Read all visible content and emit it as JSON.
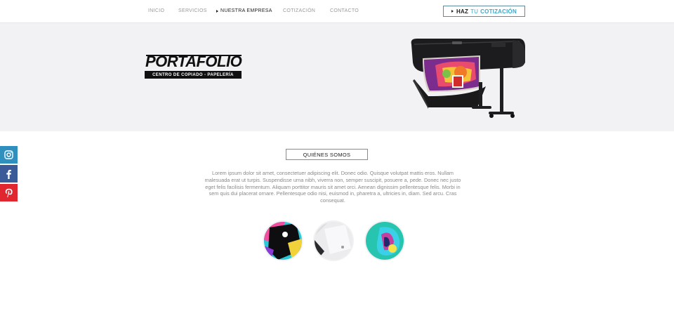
{
  "nav": {
    "items": [
      {
        "label": "INICIO",
        "active": false
      },
      {
        "label": "SERVICIOS",
        "active": false
      },
      {
        "label": "NUESTRA EMPRESA",
        "active": true
      },
      {
        "label": "COTIZACIÓN",
        "active": false
      },
      {
        "label": "CONTACTO",
        "active": false
      }
    ],
    "cta": {
      "part1": "HAZ",
      "part2": "TU",
      "part3": "COTIZACIÓN"
    }
  },
  "hero": {
    "logo_title": "PORTAFOLIO",
    "logo_subtitle": "CENTRO DE COPIADO - PAPELERÍA",
    "printer_icon": "wide-format-printer-image"
  },
  "social": [
    {
      "icon": "instagram-icon",
      "color": "#2f8fbf"
    },
    {
      "icon": "facebook-icon",
      "color": "#3b5b98"
    },
    {
      "icon": "pinterest-icon",
      "color": "#e0262f"
    }
  ],
  "about": {
    "button_label": "QUIÉNES SOMOS",
    "paragraph": "Lorem ipsum dolor sit amet, consectetuer adipiscing elit. Donec odio. Quisque volutpat mattis eros. Nullam malesuada erat ut turpis. Suspendisse urna nibh, viverra non, semper suscipit, posuere a, pede. Donec nec justo eget felis facilisis fermentum. Aliquam porttitor mauris sit amet orci. Aenean dignissim pellentesque felis. Morbi in sem quis dui placerat ornare. Pellentesque odio nisi, euismod in, pharetra a, ultricies in, diam. Sed arcu. Cras consequat."
  },
  "thumbnails": [
    "print-sample-thumbnail",
    "paper-stack-thumbnail",
    "abstract-art-thumbnail"
  ],
  "colors": {
    "accent": "#3fa7c7",
    "hero_bg": "#f2f2f4",
    "text_muted": "#8a8a8a"
  }
}
